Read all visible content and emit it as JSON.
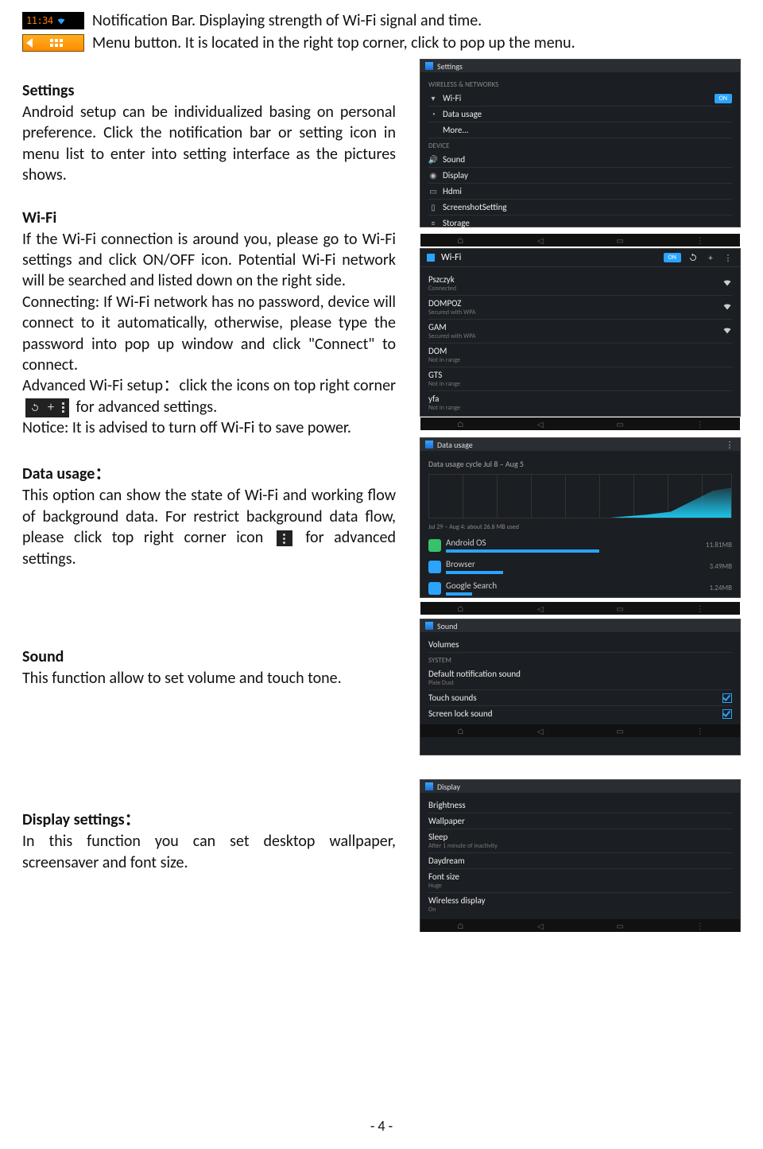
{
  "intro": {
    "notif_time": "11:34",
    "notif_text": "Notification Bar. Displaying strength of Wi-Fi signal and time.",
    "menu_text": "Menu button. It is located in the right top corner, click to pop up the menu."
  },
  "settings": {
    "heading": "Settings",
    "para": "Android setup can be individualized basing on personal preference. Click the notification bar or setting icon in menu list to enter into setting interface as the pictures shows."
  },
  "wifi": {
    "heading": "Wi-Fi",
    "p1": "If the Wi-Fi connection is around you, please go to Wi-Fi settings and click ON/OFF icon. Potential Wi-Fi network will be searched and listed down on the right side.",
    "p2": "Connecting: If Wi-Fi network has no password, device will connect to it automatically, otherwise, please type the password into pop up window and click \"Connect\" to connect.",
    "p3a": "Advanced Wi-Fi setup：click the icons on top right corner",
    "p3b": "for advanced settings.",
    "p4": "Notice: It is advised to turn off Wi-Fi to save power."
  },
  "datausage": {
    "heading": "Data usage：",
    "p1a": "This option can show the state of Wi-Fi and working flow of background data. For restrict background data flow, please click top right corner icon",
    "p1b": "for advanced settings."
  },
  "sound": {
    "heading": "Sound",
    "para": "This function allow to set volume and touch tone."
  },
  "display": {
    "heading": "Display settings：",
    "para": "In this function you can set desktop wallpaper, screensaver and font size."
  },
  "page_number": "- 4 -",
  "shot_settings": {
    "title": "Settings",
    "cat1": "WIRELESS & NETWORKS",
    "items1": [
      "Wi-Fi",
      "Data usage",
      "More..."
    ],
    "on": "ON",
    "cat2": "DEVICE",
    "items2": [
      "Sound",
      "Display",
      "Hdmi",
      "ScreenshotSetting",
      "Storage"
    ]
  },
  "shot_wifi": {
    "title": "Wi-Fi",
    "on": "ON",
    "nets": [
      {
        "name": "Pszczyk",
        "sub": "Connected"
      },
      {
        "name": "DOMPOZ",
        "sub": "Secured with WPA"
      },
      {
        "name": "GAM",
        "sub": "Secured with WPA"
      },
      {
        "name": "DOM",
        "sub": "Not in range"
      },
      {
        "name": "GTS",
        "sub": "Not in range"
      },
      {
        "name": "yfa",
        "sub": "Not in range"
      }
    ]
  },
  "shot_du": {
    "title": "Data usage",
    "cycle": "Data usage cycle  Jul 8 – Aug 5",
    "caption": "Jul 29 – Aug 4: about 26.8 MB used",
    "apps": [
      {
        "name": "Android OS",
        "val": "11.81MB",
        "color": "#36c26b",
        "w": 60
      },
      {
        "name": "Browser",
        "val": "3.49MB",
        "color": "#2aa4ff",
        "w": 22
      },
      {
        "name": "Google Search",
        "val": "1.24MB",
        "color": "#2aa4ff",
        "w": 10
      }
    ]
  },
  "shot_sound": {
    "title": "Sound",
    "items": [
      {
        "name": "Volumes",
        "sub": ""
      },
      {
        "name": "SYSTEM",
        "sub": "",
        "cat": true
      },
      {
        "name": "Default notification sound",
        "sub": "Pixie Dust"
      },
      {
        "name": "Touch sounds",
        "sub": "",
        "chk": true
      },
      {
        "name": "Screen lock sound",
        "sub": "",
        "chk": true
      }
    ]
  },
  "shot_display": {
    "title": "Display",
    "items": [
      {
        "name": "Brightness"
      },
      {
        "name": "Wallpaper"
      },
      {
        "name": "Sleep",
        "sub": "After 1 minute of inactivity"
      },
      {
        "name": "Daydream"
      },
      {
        "name": "Font size",
        "sub": "Huge"
      },
      {
        "name": "Wireless display",
        "sub": "On"
      }
    ]
  }
}
